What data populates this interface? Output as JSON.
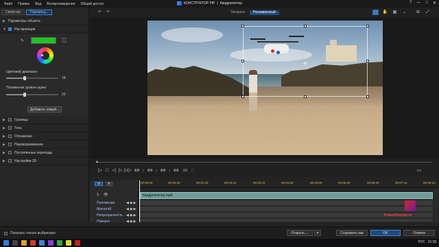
{
  "app": {
    "menu": [
      "Файл",
      "Правка",
      "Вид",
      "Воспроизведение",
      "Общий доступ"
    ],
    "title": "КОНСТРУКТОР PiP",
    "separator": "|",
    "document": "Квадрокоптер",
    "window_buttons": [
      "?",
      "—",
      "□",
      "✕"
    ]
  },
  "left_panel": {
    "tabs": [
      {
        "label": "Свойства",
        "active": false
      },
      {
        "label": "Перемещ...",
        "active": true
      }
    ],
    "object_params": "Параметры объекта",
    "pip_section": "Pip-проекция",
    "color_swatch": "#22c224",
    "color_range_label": "Цветовой диапазон",
    "color_range_value": "18",
    "color_range_fraction": 0.35,
    "noise_label": "Понижение уровня шума",
    "noise_value": "20",
    "noise_fraction": 0.35,
    "add_button": "Добавить новый...",
    "sections": [
      "Границы",
      "Тень",
      "Отражение",
      "Переворачивание",
      "Постепенные переходы",
      "Настройки 3D"
    ]
  },
  "toolbar": {
    "express": "Экспресс",
    "advanced": "Расширенный",
    "undo_icon": "↶",
    "redo_icon": "↷"
  },
  "playback": {
    "timecode": "00 : 00 : 00 : 00",
    "mode_3d": "3D",
    "fullscreen": "⛶"
  },
  "timeline": {
    "track_number": "1.",
    "clip_name": "Квадрокоптер.mp4",
    "ruler": [
      "00:00:00",
      "00:00:25",
      "00:01:20",
      "00:02:15",
      "00:03:10",
      "00:04:05",
      "00:05:00",
      "00:05:25",
      "00:06:20",
      "00:07:15",
      "00:08:10"
    ],
    "tracks": [
      "Положение",
      "Масштаб",
      "Непрозрачность",
      "Поворот"
    ]
  },
  "bottom": {
    "show_selected": "Показать только выбранную",
    "open": "Открыть ...",
    "save_as": "Сохранить как",
    "ok": "OK",
    "cancel": "Отмена"
  },
  "taskbar": {
    "lang": "РУС",
    "time": "15:38"
  },
  "watermark": {
    "text": "PowerDirector.ru"
  }
}
